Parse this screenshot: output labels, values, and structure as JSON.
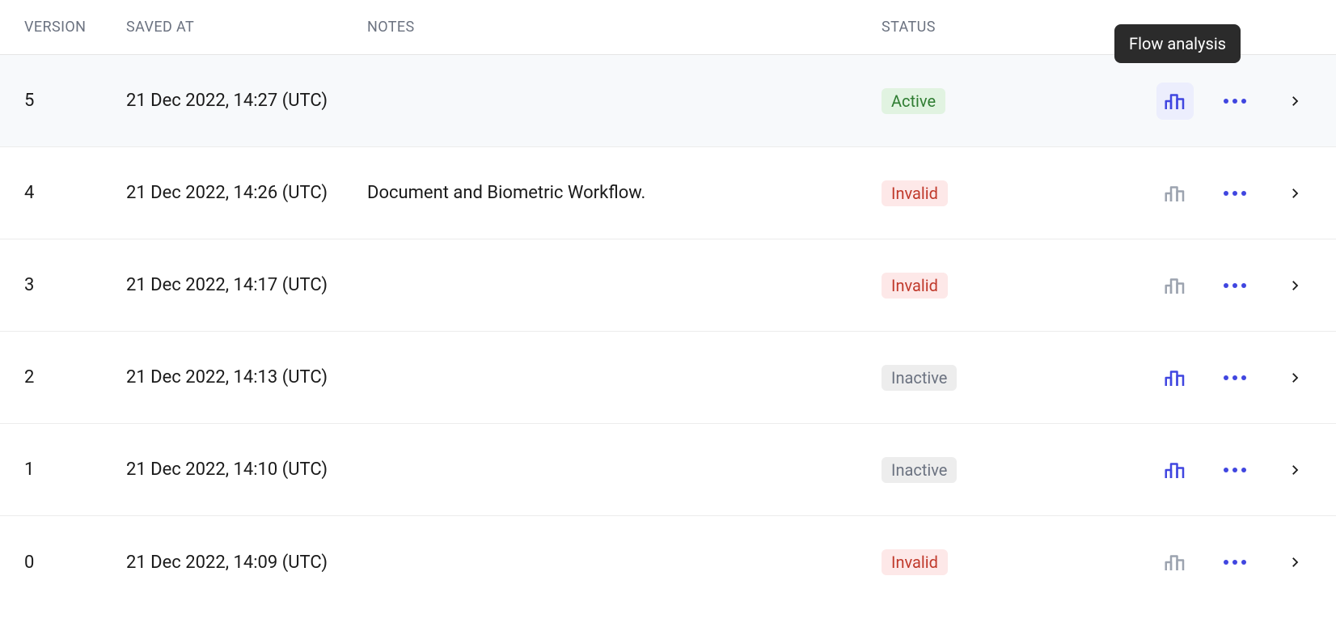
{
  "tooltip": "Flow analysis",
  "headers": {
    "version": "VERSION",
    "saved_at": "SAVED AT",
    "notes": "NOTES",
    "status": "STATUS"
  },
  "status_labels": {
    "active": "Active",
    "invalid": "Invalid",
    "inactive": "Inactive"
  },
  "rows": [
    {
      "version": "5",
      "saved_at": "21 Dec 2022, 14:27 (UTC)",
      "notes": "",
      "status": "active",
      "chart_variant": "purple",
      "highlight": true,
      "chart_active_bg": true
    },
    {
      "version": "4",
      "saved_at": "21 Dec 2022, 14:26 (UTC)",
      "notes": "Document and Biometric Workflow.",
      "status": "invalid",
      "chart_variant": "grey",
      "highlight": false,
      "chart_active_bg": false
    },
    {
      "version": "3",
      "saved_at": "21 Dec 2022, 14:17 (UTC)",
      "notes": "",
      "status": "invalid",
      "chart_variant": "grey",
      "highlight": false,
      "chart_active_bg": false
    },
    {
      "version": "2",
      "saved_at": "21 Dec 2022, 14:13 (UTC)",
      "notes": "",
      "status": "inactive",
      "chart_variant": "purple",
      "highlight": false,
      "chart_active_bg": false
    },
    {
      "version": "1",
      "saved_at": "21 Dec 2022, 14:10 (UTC)",
      "notes": "",
      "status": "inactive",
      "chart_variant": "purple",
      "highlight": false,
      "chart_active_bg": false
    },
    {
      "version": "0",
      "saved_at": "21 Dec 2022, 14:09 (UTC)",
      "notes": "",
      "status": "invalid",
      "chart_variant": "grey",
      "highlight": false,
      "chart_active_bg": false
    }
  ]
}
